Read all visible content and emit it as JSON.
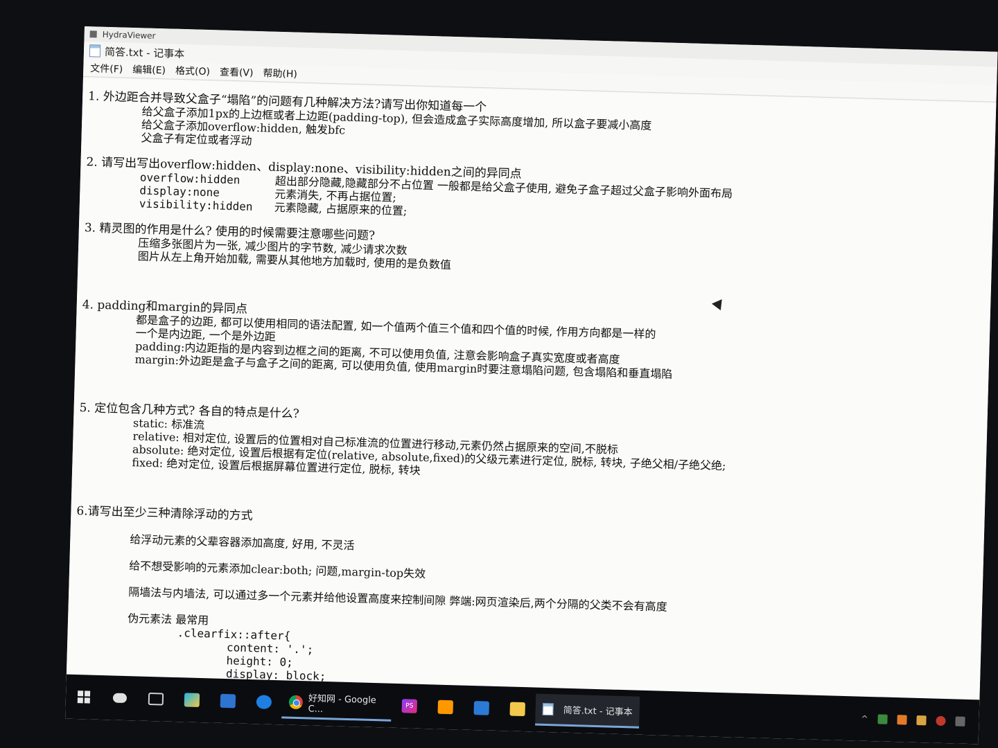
{
  "app": {
    "viewer_title": "HydraViewer"
  },
  "window": {
    "title": "简答.txt - 记事本",
    "menu": [
      "文件(F)",
      "编辑(E)",
      "格式(O)",
      "查看(V)",
      "帮助(H)"
    ]
  },
  "content": {
    "q1": {
      "title": "1.  外边距合并导致父盒子“塌陷”的问题有几种解决方法?请写出你知道每一个",
      "lines": [
        "给父盒子添加1px的上边框或者上边距(padding-top), 但会造成盒子实际高度增加, 所以盒子要减小高度",
        "给父盒子添加overflow:hidden, 触发bfc",
        "父盒子有定位或者浮动"
      ]
    },
    "q2": {
      "title": "2.  请写出写出overflow:hidden、display:none、visibility:hidden之间的异同点",
      "rows": [
        {
          "k": "overflow:hidden",
          "v": "超出部分隐藏,隐藏部分不占位置 一般都是给父盒子使用, 避免子盒子超过父盒子影响外面布局"
        },
        {
          "k": "display:none",
          "v": "元素消失, 不再占据位置;"
        },
        {
          "k": "visibility:hidden",
          "v": "元素隐藏, 占据原来的位置;"
        }
      ]
    },
    "q3": {
      "title": "3.  精灵图的作用是什么? 使用的时候需要注意哪些问题?",
      "lines": [
        "压缩多张图片为一张, 减少图片的字节数, 减少请求次数",
        "图片从左上角开始加载, 需要从其他地方加载时, 使用的是负数值"
      ]
    },
    "q4": {
      "title": "4.  padding和margin的异同点",
      "lines": [
        "都是盒子的边距, 都可以使用相同的语法配置, 如一个值两个值三个值和四个值的时候, 作用方向都是一样的",
        "一个是内边距, 一个是外边距",
        "padding:内边距指的是内容到边框之间的距离, 不可以使用负值, 注意会影响盒子真实宽度或者高度",
        "margin:外边距是盒子与盒子之间的距离, 可以使用负值, 使用margin时要注意塌陷问题, 包含塌陷和垂直塌陷"
      ]
    },
    "q5": {
      "title": "5.  定位包含几种方式? 各自的特点是什么?",
      "lines": [
        "static: 标准流",
        "relative: 相对定位, 设置后的位置相对自己标准流的位置进行移动,元素仍然占据原来的空间,不脱标",
        "absolute: 绝对定位, 设置后根据有定位(relative, absolute,fixed)的父级元素进行定位, 脱标, 转块, 子绝父相/子绝父绝;",
        "fixed: 绝对定位, 设置后根据屏幕位置进行定位, 脱标, 转块"
      ]
    },
    "q6": {
      "title": "6.请写出至少三种清除浮动的方式",
      "method1": "给浮动元素的父辈容器添加高度, 好用, 不灵活",
      "method2": "给不想受影响的元素添加clear:both; 问题,margin-top失效",
      "method3": "隔墙法与内墙法, 可以通过多一个元素并给他设置高度来控制间隙 弊端:网页渲染后,两个分隔的父类不会有高度",
      "method4": "伪元素法  最常用",
      "code": [
        ".clearfix::after{",
        "content: '.';",
        "height: 0;",
        "display: block;"
      ]
    }
  },
  "taskbar": {
    "chrome_label": "好知网 - Google C...",
    "notepad_label": "简答.txt - 记事本",
    "ps_label": "PS"
  },
  "colors": {
    "taskbar_bg": "#0b0c10",
    "active_underline": "#7aa6d8",
    "paper": "#fbfbfa"
  }
}
